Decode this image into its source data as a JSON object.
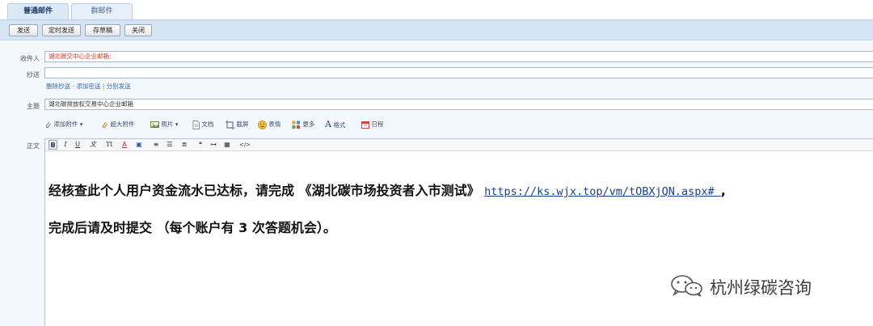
{
  "tabs": [
    {
      "label": "普通邮件",
      "active": true
    },
    {
      "label": "群邮件",
      "active": false
    }
  ],
  "toolbar": {
    "send": "发送",
    "scheduled_send": "定时发送",
    "save_draft": "存草稿",
    "close": "关闭"
  },
  "fields": {
    "to_label": "收件人",
    "to_value": "湖北碳交中心企业邮箱;",
    "cc_label": "抄送",
    "cc_value": "",
    "subject_label": "主题",
    "subject_value": "湖北碳排放权交易中心企业邮箱",
    "body_label": "正文"
  },
  "recipient_links": {
    "remove_cc": "删除抄送",
    "sep1": " - ",
    "add_bcc": "添加密送",
    "sep2": " | ",
    "separate_send": "分别发送"
  },
  "attach_bar": {
    "add_attachment": "添加附件",
    "large_attachment": "超大附件",
    "photo": "照片",
    "document": "文档",
    "screenshot": "截屏",
    "emoji": "表情",
    "more": "更多",
    "format": "格式",
    "schedule": "日程"
  },
  "editor_toolbar": [
    "B",
    "I",
    "U",
    "文",
    "Tt",
    "A",
    "▣",
    "≡",
    "☰",
    "≣",
    "❝",
    "⊶",
    "▦",
    "</>"
  ],
  "message": {
    "line1_text": "经核查此个人用户资金流水已达标，请完成 《湖北碳市场投资者入市测试》 ",
    "line1_url": "https://ks.wjx.top/vm/tOBXjQN.aspx# ",
    "line1_end": ",",
    "line2_text": "完成后请及时提交 （每个账户有 3 次答题机会）。"
  },
  "watermark": {
    "text": "杭州绿碳咨询",
    "icon": "wechat-icon"
  },
  "colors": {
    "tab_active_bg": "#dbe8f6",
    "toolbar_bg": "#d5e4f4",
    "recipient_text": "#d23a2a",
    "link": "#3a6aa8",
    "url": "#1a3f8c"
  }
}
